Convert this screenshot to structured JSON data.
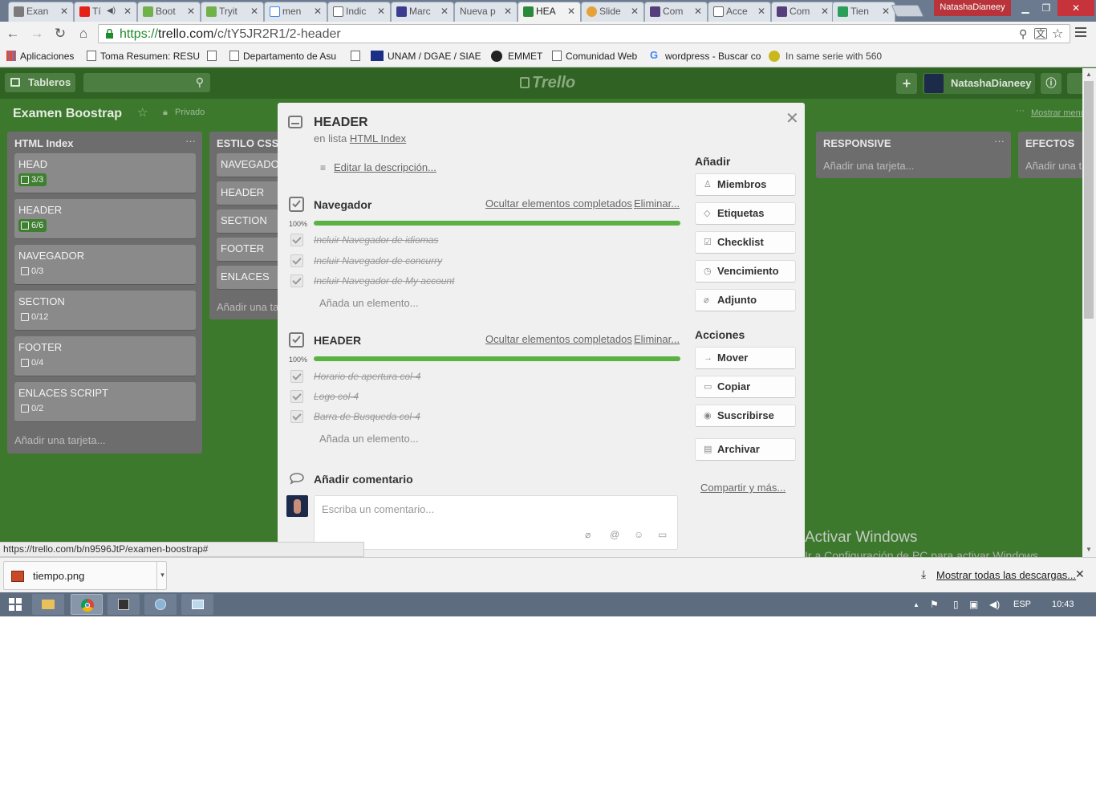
{
  "browser": {
    "tabs": [
      {
        "label": "Exan",
        "color": "#7b7b7b"
      },
      {
        "label": "Tí",
        "color": "#e62117"
      },
      {
        "label": "Boot",
        "color": "#6fb24a"
      },
      {
        "label": "Tryit",
        "color": "#6fb24a"
      },
      {
        "label": "men",
        "color": "#4285f4"
      },
      {
        "label": "Indic",
        "color": "#888888"
      },
      {
        "label": "Marc",
        "color": "#3b3b8f"
      },
      {
        "label": "Nueva p",
        "color": "#dfe4eb"
      },
      {
        "label": "HEA",
        "color": "#2a8a3c"
      },
      {
        "label": "Slide",
        "color": "#e5a238"
      },
      {
        "label": "Com",
        "color": "#563d7c"
      },
      {
        "label": "Acce",
        "color": "#888888"
      },
      {
        "label": "Com",
        "color": "#563d7c"
      },
      {
        "label": "Tien",
        "color": "#2b9e5a"
      }
    ],
    "profile_name": "NatashaDianeey",
    "url_scheme": "https://",
    "url_host": "trello.com",
    "url_path": "/c/tY5JR2R1/2-header",
    "bookmarks": [
      {
        "label": "Aplicaciones",
        "icon": "apps-icon"
      },
      {
        "label": "Toma Resumen: RESU",
        "icon": "page-icon"
      },
      {
        "label": "",
        "icon": "page-icon"
      },
      {
        "label": "Departamento de Asu",
        "icon": "page-icon"
      },
      {
        "label": "",
        "icon": "page-icon"
      },
      {
        "label": "UNAM / DGAE / SIAE",
        "icon": "unam-icon"
      },
      {
        "label": "EMMET",
        "icon": "emmet-icon"
      },
      {
        "label": "Comunidad Web",
        "icon": "page-icon"
      },
      {
        "label": "wordpress - Buscar co",
        "icon": "google-icon"
      },
      {
        "label": "In same serie with 560",
        "icon": "site-icon"
      }
    ],
    "status_url": "https://trello.com/b/n9596JtP/examen-boostrap#"
  },
  "trello": {
    "boards_label": "Tableros",
    "logo": "Trello",
    "user_name": "NatashaDianeey",
    "board_title": "Examen Boostrap",
    "privacy": "Privado",
    "show_menu": "Mostrar menú",
    "lists": [
      {
        "title": "HTML Index",
        "cards": [
          {
            "title": "HEAD",
            "badge": "3/3",
            "done": true
          },
          {
            "title": "HEADER",
            "badge": "6/6",
            "done": true
          },
          {
            "title": "NAVEGADOR",
            "badge": "0/3",
            "done": false
          },
          {
            "title": "SECTION",
            "badge": "0/12",
            "done": false
          },
          {
            "title": "FOOTER",
            "badge": "0/4",
            "done": false
          },
          {
            "title": "ENLACES SCRIPT",
            "badge": "0/2",
            "done": false
          }
        ],
        "add_card": "Añadir una tarjeta..."
      },
      {
        "title": "ESTILO CSS",
        "cards": [
          "NAVEGADOR",
          "HEADER",
          "SECTION",
          "FOOTER",
          "ENLACES"
        ],
        "add_card": "Añadir una tarjeta..."
      },
      {
        "title": "RESPONSIVE",
        "add_card": "Añadir una tarjeta..."
      },
      {
        "title": "EFECTOS",
        "add_card": "Añadir una tarjeta..."
      }
    ]
  },
  "modal": {
    "title": "HEADER",
    "in_list_prefix": "en lista",
    "in_list_name": "HTML Index",
    "edit_description": "Editar la descripción...",
    "hide_completed": "Ocultar elementos completados",
    "delete": "Eliminar...",
    "add_item": "Añada un elemento...",
    "checklists": [
      {
        "title": "Navegador",
        "percent": "100%",
        "progress": 1.0,
        "items": [
          "Incluir Navegador de idiomas",
          "Incluir Navegador de concurry",
          "Incluir Navegador de My account"
        ]
      },
      {
        "title": "HEADER",
        "percent": "100%",
        "progress": 1.0,
        "items": [
          "Horario de apertura col-4",
          "Logo col-4",
          "Barra de Busqueda col-4"
        ]
      }
    ],
    "add_section": "Añadir",
    "add_buttons": [
      "Miembros",
      "Etiquetas",
      "Checklist",
      "Vencimiento",
      "Adjunto"
    ],
    "actions_section": "Acciones",
    "action_buttons": [
      "Mover",
      "Copiar",
      "Suscribirse",
      "Archivar"
    ],
    "share": "Compartir y más...",
    "comment_title": "Añadir comentario",
    "comment_placeholder": "Escriba un comentario..."
  },
  "windows": {
    "activate_title": "Activar Windows",
    "activate_sub": "Ir a Configuración de PC para activar Windows."
  },
  "downloads": {
    "file_name": "tiempo.png",
    "show_all": "Mostrar todas las descargas..."
  },
  "taskbar": {
    "language": "ESP",
    "time": "10:43"
  }
}
